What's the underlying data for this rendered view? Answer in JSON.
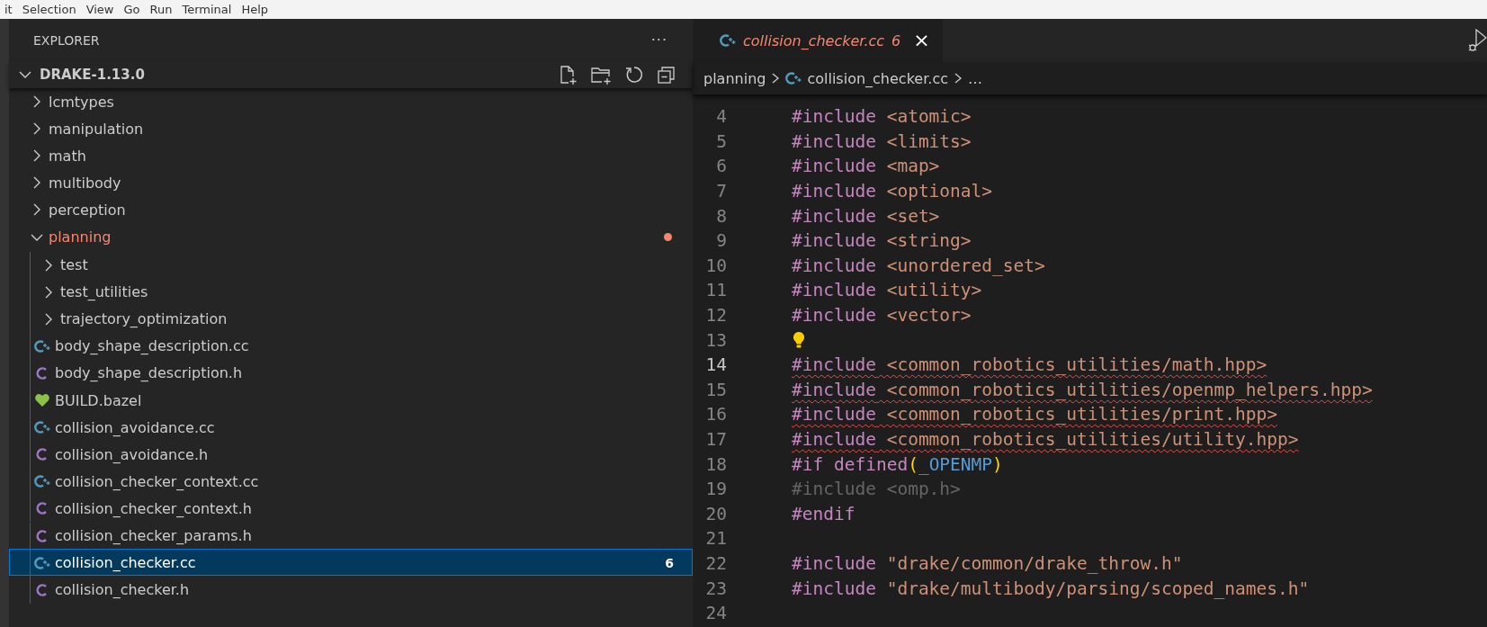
{
  "menu_bar": [
    "it",
    "Selection",
    "View",
    "Go",
    "Run",
    "Terminal",
    "Help"
  ],
  "explorer": {
    "title": "EXPLORER",
    "more": "···",
    "section": {
      "title": "DRAKE-1.13.0",
      "expanded": true
    },
    "items": [
      {
        "label": "lcmtypes",
        "kind": "folder",
        "expanded": false,
        "selected": false
      },
      {
        "label": "manipulation",
        "kind": "folder",
        "expanded": false,
        "selected": false
      },
      {
        "label": "math",
        "kind": "folder",
        "expanded": false,
        "selected": false
      },
      {
        "label": "multibody",
        "kind": "folder",
        "expanded": false,
        "selected": false
      },
      {
        "label": "perception",
        "kind": "folder",
        "expanded": false,
        "selected": false
      },
      {
        "label": "planning",
        "kind": "folder",
        "expanded": true,
        "selected": false,
        "color": "#f48771",
        "children": [
          {
            "label": "test",
            "kind": "folder",
            "expanded": false,
            "selected": false
          },
          {
            "label": "test_utilities",
            "kind": "folder",
            "expanded": false,
            "selected": false
          },
          {
            "label": "trajectory_optimization",
            "kind": "folder",
            "expanded": false,
            "selected": false
          },
          {
            "label": "body_shape_description.cc",
            "kind": "cpp",
            "selected": false
          },
          {
            "label": "body_shape_description.h",
            "kind": "header",
            "selected": false
          },
          {
            "label": "BUILD.bazel",
            "kind": "bazel",
            "selected": false
          },
          {
            "label": "collision_avoidance.cc",
            "kind": "cpp",
            "selected": false
          },
          {
            "label": "collision_avoidance.h",
            "kind": "header",
            "selected": false
          },
          {
            "label": "collision_checker_context.cc",
            "kind": "cpp",
            "selected": false
          },
          {
            "label": "collision_checker_context.h",
            "kind": "header",
            "selected": false
          },
          {
            "label": "collision_checker_params.h",
            "kind": "header",
            "selected": false
          },
          {
            "label": "collision_checker.cc",
            "kind": "cpp",
            "selected": true,
            "badge": "6"
          },
          {
            "label": "collision_checker.h",
            "kind": "header",
            "selected": false
          }
        ]
      }
    ]
  },
  "editor": {
    "tab": {
      "label": "collision_checker.cc",
      "problems": "6",
      "close": "×",
      "selected": true
    },
    "breadcrumb": [
      "planning",
      "collision_checker.cc",
      "…"
    ],
    "lines": [
      {
        "number": "4",
        "error": false,
        "tokens": [
          {
            "kind": "keyword",
            "text": "#include"
          },
          {
            "kind": "string",
            "text": " <atomic>"
          }
        ]
      },
      {
        "number": "5",
        "error": false,
        "tokens": [
          {
            "kind": "keyword",
            "text": "#include"
          },
          {
            "kind": "string",
            "text": " <limits>"
          }
        ]
      },
      {
        "number": "6",
        "error": false,
        "tokens": [
          {
            "kind": "keyword",
            "text": "#include"
          },
          {
            "kind": "string",
            "text": " <map>"
          }
        ]
      },
      {
        "number": "7",
        "error": false,
        "tokens": [
          {
            "kind": "keyword",
            "text": "#include"
          },
          {
            "kind": "string",
            "text": " <optional>"
          }
        ]
      },
      {
        "number": "8",
        "error": false,
        "tokens": [
          {
            "kind": "keyword",
            "text": "#include"
          },
          {
            "kind": "string",
            "text": " <set>"
          }
        ]
      },
      {
        "number": "9",
        "error": false,
        "tokens": [
          {
            "kind": "keyword",
            "text": "#include"
          },
          {
            "kind": "string",
            "text": " <string>"
          }
        ]
      },
      {
        "number": "10",
        "error": false,
        "tokens": [
          {
            "kind": "keyword",
            "text": "#include"
          },
          {
            "kind": "string",
            "text": " <unordered_set>"
          }
        ]
      },
      {
        "number": "11",
        "error": false,
        "tokens": [
          {
            "kind": "keyword",
            "text": "#include"
          },
          {
            "kind": "string",
            "text": " <utility>"
          }
        ]
      },
      {
        "number": "12",
        "error": false,
        "tokens": [
          {
            "kind": "keyword",
            "text": "#include"
          },
          {
            "kind": "string",
            "text": " <vector>"
          }
        ]
      },
      {
        "number": "13",
        "lightbulb": true
      },
      {
        "number": "14",
        "error": true,
        "active": true,
        "tokens": [
          {
            "kind": "keyword",
            "text": "#include"
          },
          {
            "kind": "string",
            "text": " <common_robotics_utilities/math.hpp>"
          }
        ]
      },
      {
        "number": "15",
        "error": true,
        "tokens": [
          {
            "kind": "keyword",
            "text": "#include"
          },
          {
            "kind": "string",
            "text": " <common_robotics_utilities/openmp_helpers.hpp>"
          }
        ]
      },
      {
        "number": "16",
        "error": true,
        "tokens": [
          {
            "kind": "keyword",
            "text": "#include"
          },
          {
            "kind": "string",
            "text": " <common_robotics_utilities/print.hpp>"
          }
        ]
      },
      {
        "number": "17",
        "error": true,
        "tokens": [
          {
            "kind": "keyword",
            "text": "#include"
          },
          {
            "kind": "string",
            "text": " <common_robotics_utilities/utility.hpp>"
          }
        ]
      },
      {
        "number": "18",
        "error": false,
        "tokens": [
          {
            "kind": "keyword",
            "text": "#if defined"
          },
          {
            "kind": "paren",
            "text": "("
          },
          {
            "kind": "macro",
            "text": "_OPENMP"
          },
          {
            "kind": "paren",
            "text": ")"
          }
        ]
      },
      {
        "number": "19",
        "error": false,
        "tokens": [
          {
            "kind": "inactive",
            "text": "#include <omp.h>"
          }
        ]
      },
      {
        "number": "20",
        "error": false,
        "tokens": [
          {
            "kind": "keyword",
            "text": "#endif"
          }
        ]
      },
      {
        "number": "21"
      },
      {
        "number": "22",
        "error": false,
        "tokens": [
          {
            "kind": "keyword",
            "text": "#include"
          },
          {
            "kind": "string",
            "text": " \"drake/common/drake_throw.h\""
          }
        ]
      },
      {
        "number": "23",
        "error": false,
        "tokens": [
          {
            "kind": "keyword",
            "text": "#include"
          },
          {
            "kind": "string",
            "text": " \"drake/multibody/parsing/scoped_names.h\""
          }
        ]
      },
      {
        "number": "24"
      }
    ]
  }
}
